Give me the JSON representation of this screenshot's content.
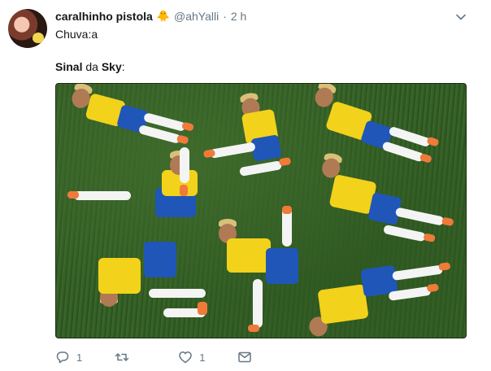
{
  "tweet": {
    "name": "caralhinho pistola",
    "name_emoji": "🐥",
    "handle": "@ahYalli",
    "separator": "·",
    "time": "2 h",
    "line1": "Chuva:a",
    "line2_bold1": "Sinal",
    "line2_mid": " da ",
    "line2_bold2": "Sky",
    "line2_end": ":"
  },
  "actions": {
    "reply_count": "1",
    "retweet_count": "",
    "like_count": "1"
  },
  "icons": {
    "menu": "chevron-down-icon",
    "reply": "reply-icon",
    "retweet": "retweet-icon",
    "like": "heart-icon",
    "dm": "envelope-icon"
  },
  "colors": {
    "text": "#14171a",
    "muted": "#657786",
    "shirt": "#f2d21b",
    "shorts": "#1f56b8",
    "pitch": "#355f26"
  }
}
